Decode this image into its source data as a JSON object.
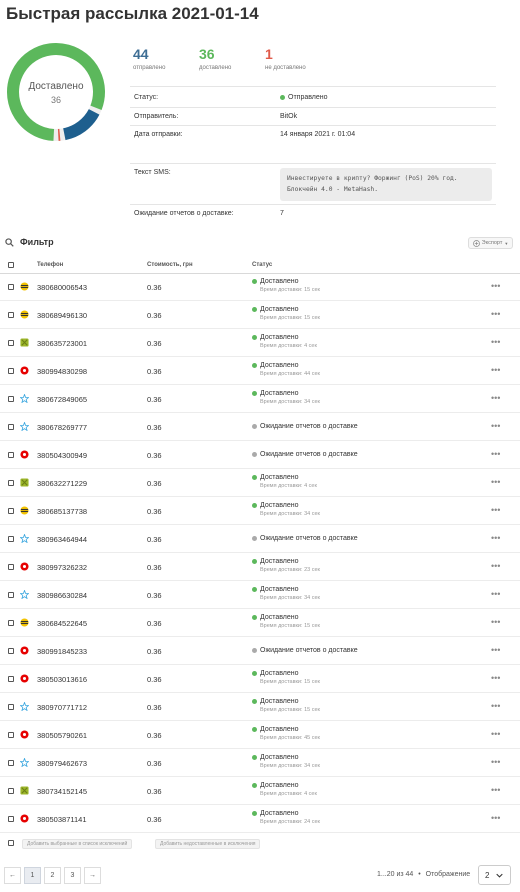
{
  "page": {
    "title": "Быстрая рассылка 2021-01-14"
  },
  "donut": {
    "label": "Доставлено",
    "value": "36",
    "segments": [
      {
        "name": "Доставлено",
        "value": 36,
        "color": "#5cb85c"
      },
      {
        "name": "Ожидание",
        "value": 7,
        "color": "#1e5f8e"
      },
      {
        "name": "Не доставлено",
        "value": 1,
        "color": "#e05a4a"
      }
    ]
  },
  "stats": [
    {
      "value": "44",
      "label": "отправлено",
      "color": "#3e6e94"
    },
    {
      "value": "36",
      "label": "доставлено",
      "color": "#5cb85c"
    },
    {
      "value": "1",
      "label": "не доставлено",
      "color": "#e05a4a"
    }
  ],
  "info": {
    "status_label": "Статус:",
    "status_value": "Отправлено",
    "sender_label": "Отправитель:",
    "sender_value": "BitOk",
    "date_label": "Дата отправки:",
    "date_value": "14 января 2021 г. 01:04",
    "sms_label": "Текст SMS:",
    "sms_text": "Инвестируете в крипту? Форжинг (PoS) 20% год. Блокчейн 4.0 - MetaHash.",
    "waiting_label": "Ожидание отчетов о доставке:",
    "waiting_value": "7"
  },
  "toolbar": {
    "filter_label": "Фильтр",
    "export_label": "Экспорт"
  },
  "table": {
    "columns": {
      "phone": "Телефон",
      "cost": "Стоимость, грн",
      "status": "Статус"
    },
    "rows": [
      {
        "operator": "kyivstar",
        "phone": "380680006543",
        "cost": "0.36",
        "status": "Доставлено",
        "time": "Время доставки: 15 сек"
      },
      {
        "operator": "kyivstar",
        "phone": "380689496130",
        "cost": "0.36",
        "status": "Доставлено",
        "time": "Время доставки: 15 сек"
      },
      {
        "operator": "lifecell",
        "phone": "380635723001",
        "cost": "0.36",
        "status": "Доставлено",
        "time": "Время доставки: 4 сек"
      },
      {
        "operator": "vodafone",
        "phone": "380994830298",
        "cost": "0.36",
        "status": "Доставлено",
        "time": "Время доставки: 44 сек"
      },
      {
        "operator": "kyivstar-star",
        "phone": "380672849065",
        "cost": "0.36",
        "status": "Доставлено",
        "time": "Время доставки: 34 сек"
      },
      {
        "operator": "kyivstar-star",
        "phone": "380678269777",
        "cost": "0.36",
        "status": "Ожидание отчетов о доставке",
        "time": ""
      },
      {
        "operator": "vodafone",
        "phone": "380504300949",
        "cost": "0.36",
        "status": "Ожидание отчетов о доставке",
        "time": ""
      },
      {
        "operator": "lifecell",
        "phone": "380632271229",
        "cost": "0.36",
        "status": "Доставлено",
        "time": "Время доставки: 4 сек"
      },
      {
        "operator": "kyivstar",
        "phone": "380685137738",
        "cost": "0.36",
        "status": "Доставлено",
        "time": "Время доставки: 34 сек"
      },
      {
        "operator": "kyivstar-star",
        "phone": "380963464944",
        "cost": "0.36",
        "status": "Ожидание отчетов о доставке",
        "time": ""
      },
      {
        "operator": "vodafone",
        "phone": "380997326232",
        "cost": "0.36",
        "status": "Доставлено",
        "time": "Время доставки: 23 сек"
      },
      {
        "operator": "kyivstar-star",
        "phone": "380986630284",
        "cost": "0.36",
        "status": "Доставлено",
        "time": "Время доставки: 34 сек"
      },
      {
        "operator": "kyivstar",
        "phone": "380684522645",
        "cost": "0.36",
        "status": "Доставлено",
        "time": "Время доставки: 15 сек"
      },
      {
        "operator": "vodafone",
        "phone": "380991845233",
        "cost": "0.36",
        "status": "Ожидание отчетов о доставке",
        "time": ""
      },
      {
        "operator": "vodafone",
        "phone": "380503013616",
        "cost": "0.36",
        "status": "Доставлено",
        "time": "Время доставки: 15 сек"
      },
      {
        "operator": "kyivstar-star",
        "phone": "380970771712",
        "cost": "0.36",
        "status": "Доставлено",
        "time": "Время доставки: 15 сек"
      },
      {
        "operator": "vodafone",
        "phone": "380505790261",
        "cost": "0.36",
        "status": "Доставлено",
        "time": "Время доставки: 45 сек"
      },
      {
        "operator": "kyivstar-star",
        "phone": "380979462673",
        "cost": "0.36",
        "status": "Доставлено",
        "time": "Время доставки: 34 сек"
      },
      {
        "operator": "lifecell",
        "phone": "380734152145",
        "cost": "0.36",
        "status": "Доставлено",
        "time": "Время доставки: 4 сек"
      },
      {
        "operator": "vodafone",
        "phone": "380503871141",
        "cost": "0.36",
        "status": "Доставлено",
        "time": "Время доставки: 24 сек"
      }
    ]
  },
  "bulk": {
    "add_selected": "Добавить выбранные в список исключений",
    "add_undelivered": "Добавить недоставленные в исключения"
  },
  "pagination": {
    "prev": "←",
    "pages": [
      "1",
      "2",
      "3"
    ],
    "next": "→",
    "info": "1...20 из 44",
    "per_page_label": "Отображение",
    "per_page_value": "2"
  },
  "colors": {
    "delivered": "#5cb85c",
    "waiting": "#aaaaaa",
    "failed": "#e05a4a",
    "kyivstar": "#f3c300",
    "vodafone": "#e60000",
    "lifecell": "#9cb62a",
    "star": "#3fa9e0"
  }
}
